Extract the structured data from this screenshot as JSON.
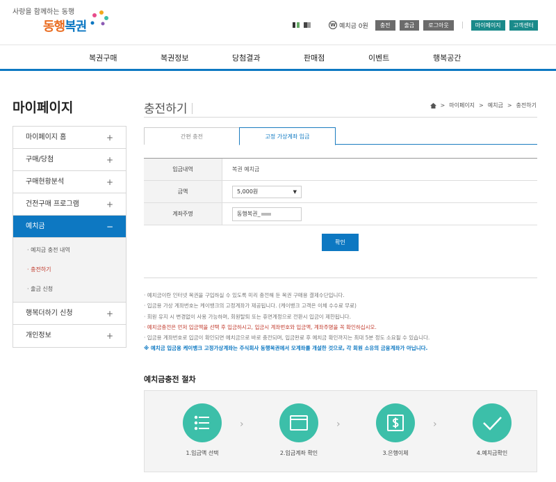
{
  "header": {
    "slogan": "사랑을 함께하는 동행",
    "brand_a": "동행",
    "brand_b": "복권",
    "wallet_symbol": "W",
    "wallet": "예치금 0원",
    "charge": "충전",
    "withdraw": "출금",
    "logout": "로그아웃",
    "mypage": "마이페이지",
    "support": "고객센터"
  },
  "gnb": [
    "복권구매",
    "복권정보",
    "당첨결과",
    "판매점",
    "이벤트",
    "행복공간"
  ],
  "sidebar": {
    "title": "마이페이지",
    "items": [
      {
        "label": "마이페이지 홈",
        "icon": "+"
      },
      {
        "label": "구매/당첨",
        "icon": "+"
      },
      {
        "label": "구매현황분석",
        "icon": "+"
      },
      {
        "label": "건전구매 프로그램",
        "icon": "+"
      },
      {
        "label": "예치금",
        "icon": "−"
      },
      {
        "label": "행복더하기 신청",
        "icon": "+"
      },
      {
        "label": "개인정보",
        "icon": "+"
      }
    ],
    "subs": [
      {
        "label": "· 예치금 충전 내역"
      },
      {
        "label": "· 충전하기"
      },
      {
        "label": "· 출금 신청"
      }
    ]
  },
  "content": {
    "title": "충전하기",
    "breadcrumb": [
      "마이페이지",
      "예치금",
      "충전하기"
    ],
    "breadcrumb_sep": ">",
    "tabs": [
      "간편 충전",
      "고정 가상계좌 입금"
    ],
    "form": {
      "row1_label": "입금내역",
      "row1_value": "복권 예치금",
      "row2_label": "금액",
      "row2_value": "5,000원",
      "row2_caret": "▼",
      "row3_label": "계좌주명",
      "row3_value": "동행복권_"
    },
    "confirm": "확인",
    "notes": [
      "· 예치금이란 인터넷 복권을 구입하실 수 있도록 미리 충전해 둔 복권 구매용 결제수단입니다.",
      "· 입금용 가상 계좌번호는 케이뱅크의 고정계좌가 제공됩니다. (케이뱅크 고객은 이체 수수료 무료)",
      "· 회원 유지 시 변경없이 사용 가능하며, 회원탈퇴 또는 휴면계정으로 전환시 입금이 제한됩니다.",
      "· 예치금충전은 먼저 입금액을 선택 후 입금하시고, 입금시 계좌번호와 입금액, 계좌주명을 꼭 확인하십시오.",
      "· 입금용 계좌번호로 입금이 확인되면 예치금으로 바로 충전되며, 입금완료 후 예치금 확인까지는 최대 5분 정도 소요될 수 있습니다.",
      "※ 예치금 입금용 케이뱅크 고정가상계좌는 주식회사 동행복권에서 모계좌를 개설한 것으로, 각 회원 소유의 금융계좌가 아닙니다."
    ],
    "process_title": "예치금충전 절차",
    "steps": [
      "1.입금액 선택",
      "2.입금계좌 확인",
      "3.은행이체",
      "4.예치금확인"
    ],
    "step_arrow": "›"
  },
  "colors": {
    "accent_blue": "#0d78c2",
    "teal": "#3cbfa9",
    "brand_orange": "#e96b1f",
    "note_red": "#c0392b"
  },
  "icons": [
    "home-icon",
    "list-icon",
    "window-icon",
    "dollar-icon",
    "check-icon",
    "wallet-icon"
  ]
}
